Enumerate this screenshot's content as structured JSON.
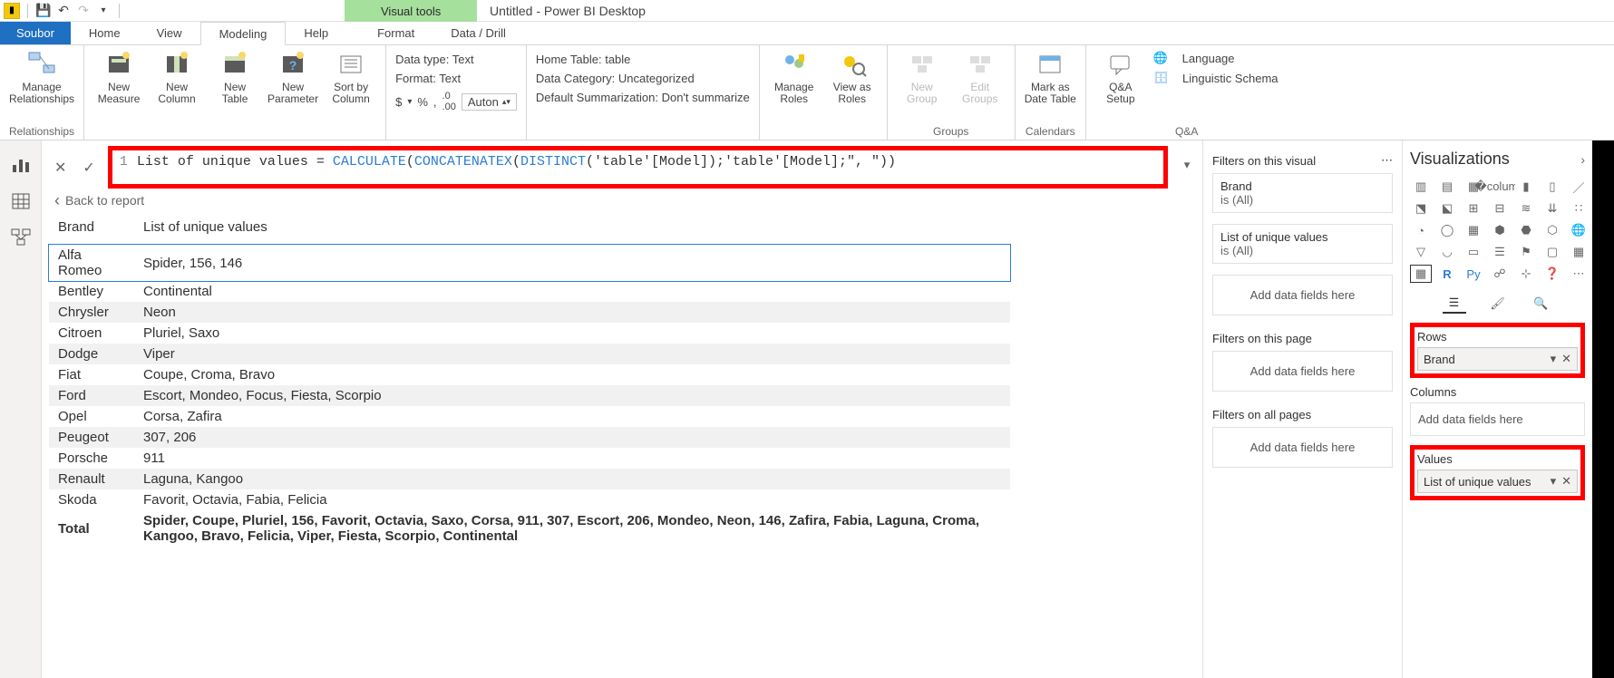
{
  "window": {
    "title": "Untitled - Power BI Desktop",
    "visual_tools": "Visual tools"
  },
  "tabs": {
    "file": "Soubor",
    "items": [
      "Home",
      "View",
      "Modeling",
      "Help",
      "Format",
      "Data / Drill"
    ],
    "active": "Modeling"
  },
  "ribbon": {
    "relationships": {
      "manage": "Manage\nRelationships",
      "group": "Relationships"
    },
    "calc": {
      "new_measure": "New\nMeasure",
      "new_column": "New\nColumn",
      "new_table": "New\nTable",
      "new_parameter": "New\nParameter",
      "sort_by": "Sort by\nColumn"
    },
    "format": {
      "data_type": "Data type: Text",
      "format": "Format: Text",
      "currency": "$",
      "percent": "%",
      "comma": ",",
      "decimals": ".0",
      "auto": "Auton"
    },
    "props": {
      "home_table": "Home Table: table",
      "category": "Data Category: Uncategorized",
      "summarization": "Default Summarization: Don't summarize"
    },
    "security": {
      "manage_roles": "Manage\nRoles",
      "view_as": "View as\nRoles"
    },
    "groups": {
      "new_group": "New\nGroup",
      "edit_groups": "Edit\nGroups",
      "label": "Groups"
    },
    "calendars": {
      "mark": "Mark as\nDate Table",
      "label": "Calendars"
    },
    "qa": {
      "setup": "Q&A\nSetup",
      "language": "Language",
      "schema": "Linguistic Schema",
      "label": "Q&A"
    }
  },
  "formula": {
    "line_no": "1",
    "prefix": "List of unique values = ",
    "f1": "CALCULATE",
    "p1": "(",
    "f2": "CONCATENATEX",
    "p2": "(",
    "f3": "DISTINCT",
    "p3": "(",
    "arg1": "'table'[Model]);'table'[Model];\", \"",
    "close": "))"
  },
  "back": "Back to report",
  "table": {
    "col_brand": "Brand",
    "col_values": "List of unique values",
    "rows": [
      {
        "brand": "Alfa Romeo",
        "values": "Spider, 156, 146"
      },
      {
        "brand": "Bentley",
        "values": "Continental"
      },
      {
        "brand": "Chrysler",
        "values": "Neon"
      },
      {
        "brand": "Citroen",
        "values": "Pluriel, Saxo"
      },
      {
        "brand": "Dodge",
        "values": "Viper"
      },
      {
        "brand": "Fiat",
        "values": "Coupe, Croma, Bravo"
      },
      {
        "brand": "Ford",
        "values": "Escort, Mondeo, Focus, Fiesta, Scorpio"
      },
      {
        "brand": "Opel",
        "values": "Corsa, Zafira"
      },
      {
        "brand": "Peugeot",
        "values": "307, 206"
      },
      {
        "brand": "Porsche",
        "values": "911"
      },
      {
        "brand": "Renault",
        "values": "Laguna, Kangoo"
      },
      {
        "brand": "Skoda",
        "values": "Favorit, Octavia, Fabia, Felicia"
      }
    ],
    "total_label": "Total",
    "total_values": "Spider, Coupe, Pluriel, 156, Favorit, Octavia, Saxo, Corsa, 911, 307, Escort, 206, Mondeo, Neon, 146, Zafira, Fabia, Laguna, Croma, Kangoo, Bravo, Felicia, Viper, Fiesta, Scorpio, Continental"
  },
  "filters": {
    "visual_title": "Filters on this visual",
    "brand": "Brand",
    "brand_state": "is (All)",
    "unique": "List of unique values",
    "unique_state": "is (All)",
    "add": "Add data fields here",
    "page_title": "Filters on this page",
    "all_title": "Filters on all pages"
  },
  "vis": {
    "title": "Visualizations",
    "rows_label": "Rows",
    "rows_field": "Brand",
    "cols_label": "Columns",
    "cols_placeholder": "Add data fields here",
    "values_label": "Values",
    "values_field": "List of unique values"
  }
}
